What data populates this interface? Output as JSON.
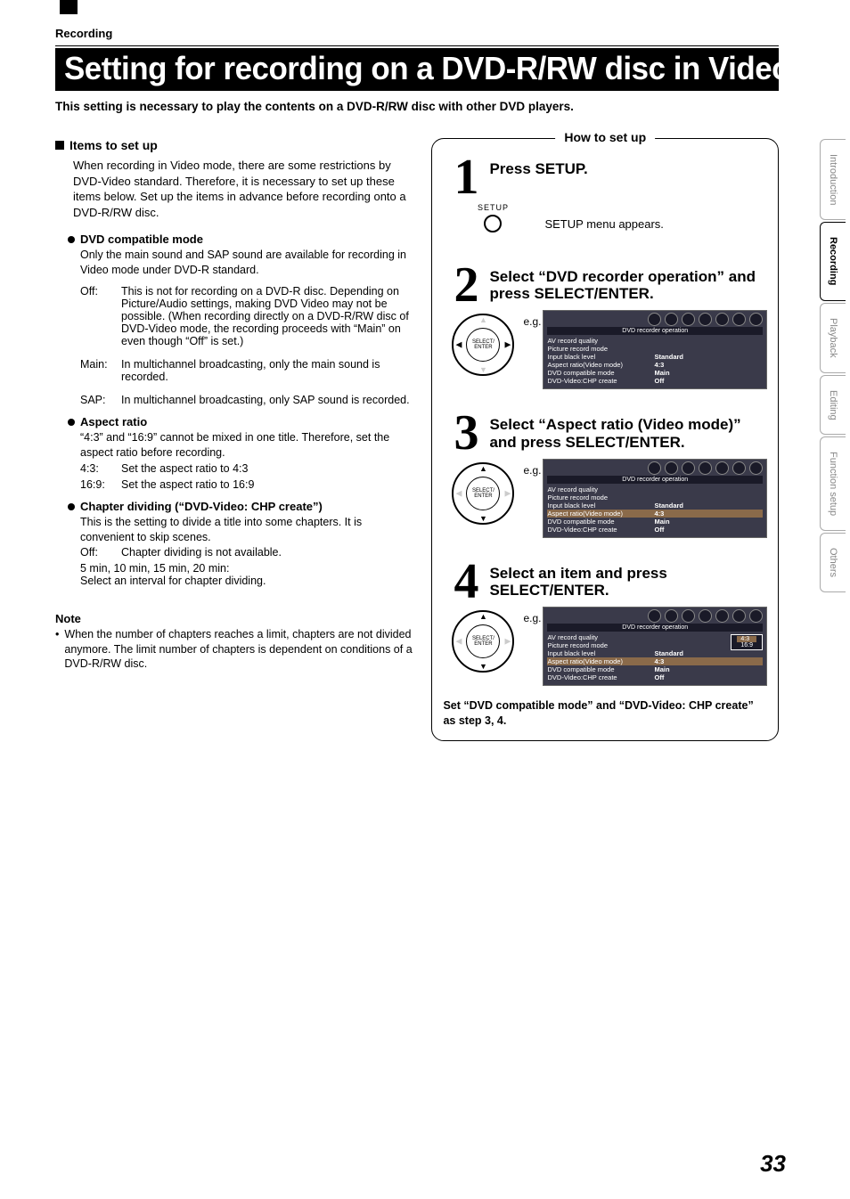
{
  "section": "Recording",
  "title": "Setting for recording on a DVD-R/RW disc in Video mode",
  "intro": "This setting is necessary to play the contents on a DVD-R/RW disc with other DVD players.",
  "left": {
    "items_heading": "Items to set up",
    "items_intro": "When recording in Video mode, there are some restrictions by DVD-Video standard. Therefore, it is necessary to set up these items below. Set up the items in advance before recording onto a DVD-R/RW disc.",
    "dvd_mode": {
      "title": "DVD compatible mode",
      "desc": "Only the main sound and SAP sound are available for recording in Video mode under DVD-R standard.",
      "off_k": "Off:",
      "off_v": "This is not for recording on a DVD-R disc. Depending on Picture/Audio settings, making DVD Video may not be possible. (When recording directly on a DVD-R/RW disc of DVD-Video mode, the recording proceeds with “Main” on even though “Off” is set.)",
      "main_k": "Main:",
      "main_v": "In multichannel broadcasting, only the main sound is recorded.",
      "sap_k": "SAP:",
      "sap_v": "In multichannel broadcasting, only SAP sound is recorded."
    },
    "aspect": {
      "title": "Aspect ratio",
      "desc": "“4:3” and “16:9” cannot be mixed in one title. Therefore, set the aspect ratio before recording.",
      "r1k": "4:3:",
      "r1v": "Set the aspect ratio to 4:3",
      "r2k": "16:9:",
      "r2v": "Set the aspect ratio to 16:9"
    },
    "chapter": {
      "title": "Chapter dividing (“DVD-Video: CHP create”)",
      "desc": "This is the setting to divide a title into some chapters. It is convenient to skip scenes.",
      "offk": "Off:",
      "offv": "Chapter dividing is not available.",
      "line2": "5 min, 10 min, 15 min, 20 min:",
      "line3": "Select an interval for chapter dividing."
    },
    "note_h": "Note",
    "note": "When the number of chapters reaches a limit, chapters are not divided anymore. The limit number of chapters is dependent on conditions of a DVD-R/RW disc."
  },
  "right": {
    "how_title": "How to set up",
    "s1": {
      "num": "1",
      "text": "Press SETUP.",
      "sub": "SETUP menu appears.",
      "btn": "SETUP"
    },
    "s2": {
      "num": "2",
      "text": "Select “DVD recorder operation” and press SELECT/ENTER.",
      "nav": "SELECT/\nENTER",
      "eg": "e.g."
    },
    "s3": {
      "num": "3",
      "text": "Select “Aspect ratio (Video mode)” and press SELECT/ENTER.",
      "nav": "SELECT/\nENTER",
      "eg": "e.g."
    },
    "s4": {
      "num": "4",
      "text": "Select an item and press SELECT/ENTER.",
      "nav": "SELECT/\nENTER",
      "eg": "e.g."
    },
    "post": "Set “DVD compatible mode” and “DVD-Video: CHP create” as step 3, 4.",
    "osd": {
      "bar": "DVD recorder operation",
      "rows": [
        {
          "k": "AV record quality",
          "v": ""
        },
        {
          "k": "Picture record mode",
          "v": ""
        },
        {
          "k": "Input black level",
          "v": "Standard"
        },
        {
          "k": "Aspect ratio(Video mode)",
          "v": "4:3"
        },
        {
          "k": "DVD compatible mode",
          "v": "Main"
        },
        {
          "k": "DVD-Video:CHP create",
          "v": "Off"
        }
      ],
      "popup": [
        "4:3",
        "16:9"
      ]
    }
  },
  "tabs": [
    "Introduction",
    "Recording",
    "Playback",
    "Editing",
    "Function setup",
    "Others"
  ],
  "active_tab": 1,
  "page": "33"
}
